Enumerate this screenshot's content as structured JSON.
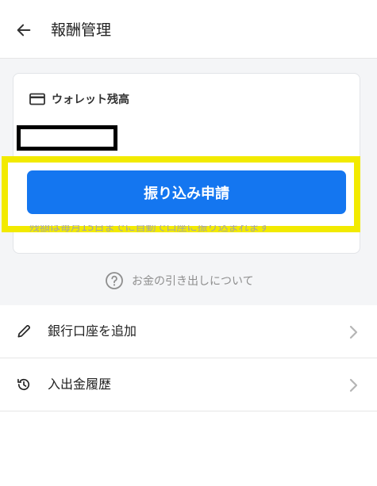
{
  "header": {
    "back_icon": "arrow-left-icon",
    "title": "報酬管理"
  },
  "wallet": {
    "icon": "credit-card-icon",
    "title": "ウォレット残高",
    "balance": "",
    "apply_button_label": "振り込み申請",
    "note": "残額は毎月15日までに自動で口座に振り込まれます"
  },
  "help": {
    "icon": "question-circle-icon",
    "label": "お金の引き出しについて"
  },
  "menu": {
    "items": [
      {
        "icon": "pencil-icon",
        "label": "銀行口座を追加"
      },
      {
        "icon": "history-icon",
        "label": "入出金履歴"
      }
    ]
  },
  "colors": {
    "accent": "#1476f0",
    "highlight": "#f2ea00",
    "background": "#f4f5f7",
    "muted_text": "#a6a6a6"
  }
}
